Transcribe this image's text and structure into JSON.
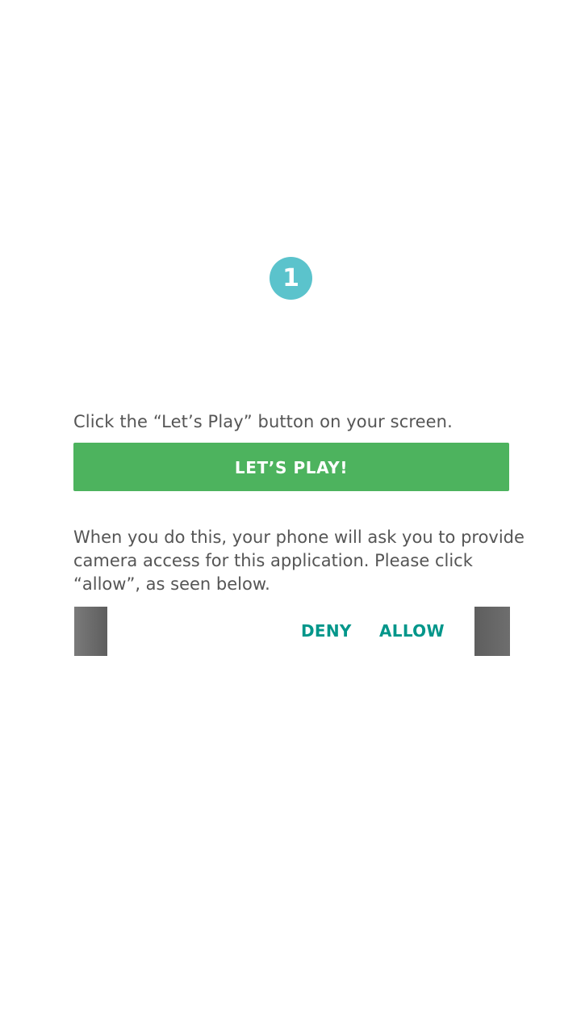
{
  "step": {
    "number": "1"
  },
  "instructions": {
    "click_text": "Click the “Let’s Play” button on your screen.",
    "play_button_label": "LET’S PLAY!",
    "description": "When you do this, your phone will ask you to provide camera access for this application. Please click “allow”, as seen below."
  },
  "permission_preview": {
    "deny_label": "DENY",
    "allow_label": "ALLOW"
  },
  "colors": {
    "badge": "#5bc3cc",
    "play_button": "#4db35e",
    "dialog_action": "#00968a",
    "body_text": "#555555"
  }
}
